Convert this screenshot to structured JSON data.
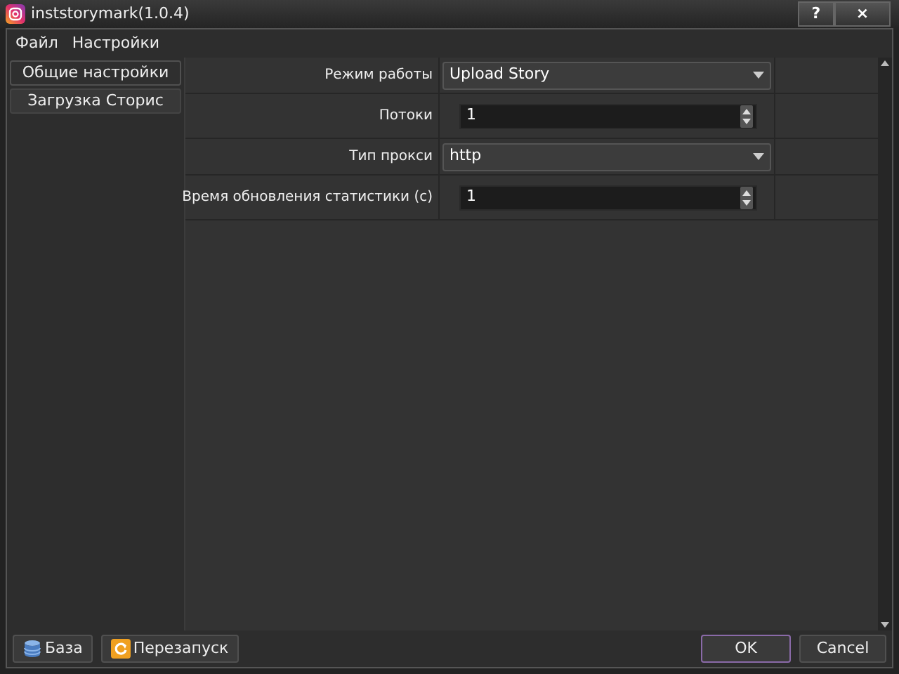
{
  "window": {
    "title": "inststorymark(1.0.4)",
    "buttons": [
      "?",
      "×"
    ]
  },
  "menu": [
    "Файл",
    "Настройки"
  ],
  "sidebar": {
    "items": [
      {
        "label": "Общие настройки",
        "selected": true
      },
      {
        "label": "Загрузка Сторис",
        "selected": false
      }
    ]
  },
  "settings": [
    {
      "label": "Режим работы",
      "kind": "select",
      "value": "Upload Story"
    },
    {
      "label": "Потоки",
      "kind": "spin",
      "value": "1"
    },
    {
      "label": "Тип прокси",
      "kind": "select",
      "value": "http"
    },
    {
      "label": "Время обновления статистики (с)",
      "kind": "spin",
      "value": "1"
    }
  ],
  "footer": {
    "left_buttons": [
      {
        "label": "База",
        "kind": "database"
      },
      {
        "label": "Перезапуск",
        "kind": "restart"
      }
    ],
    "ok": "OK",
    "cancel": "Cancel"
  }
}
